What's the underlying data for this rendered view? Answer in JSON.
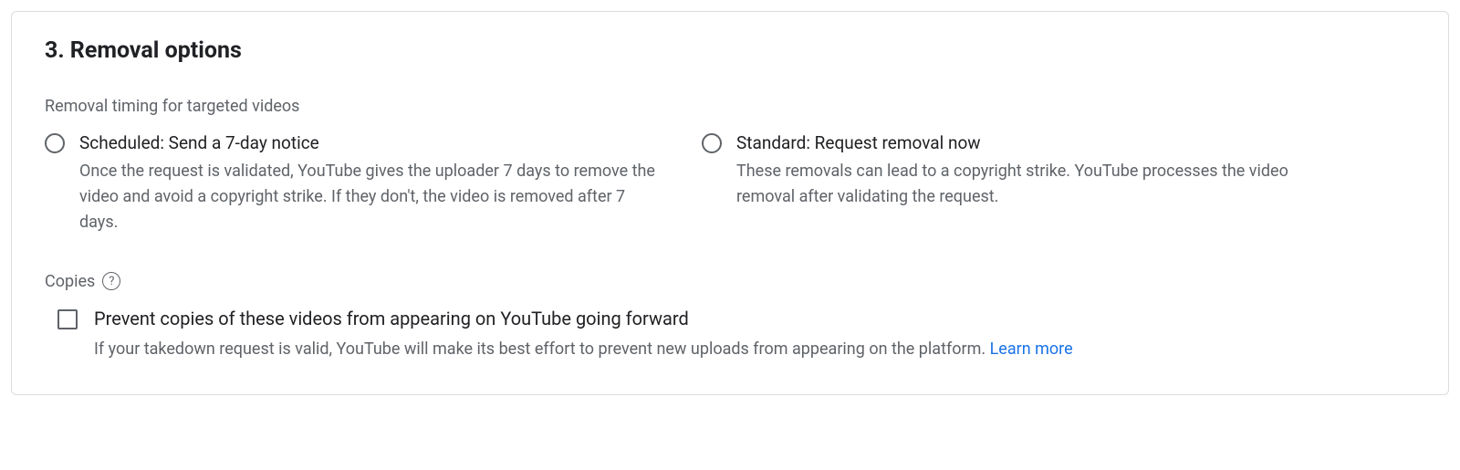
{
  "section": {
    "heading": "3. Removal options",
    "timing_label": "Removal timing for targeted videos",
    "options": {
      "scheduled": {
        "title": "Scheduled: Send a 7-day notice",
        "desc": "Once the request is validated, YouTube gives the uploader 7 days to remove the video and avoid a copyright strike. If they don't, the video is removed after 7 days."
      },
      "standard": {
        "title": "Standard: Request removal now",
        "desc": "These removals can lead to a copyright strike. YouTube processes the video removal after validating the request."
      }
    },
    "copies": {
      "label": "Copies",
      "help_glyph": "?",
      "checkbox_title": "Prevent copies of these videos from appearing on YouTube going forward",
      "checkbox_desc": "If your takedown request is valid, YouTube will make its best effort to prevent new uploads from appearing on the platform. ",
      "learn_more": "Learn more"
    }
  }
}
